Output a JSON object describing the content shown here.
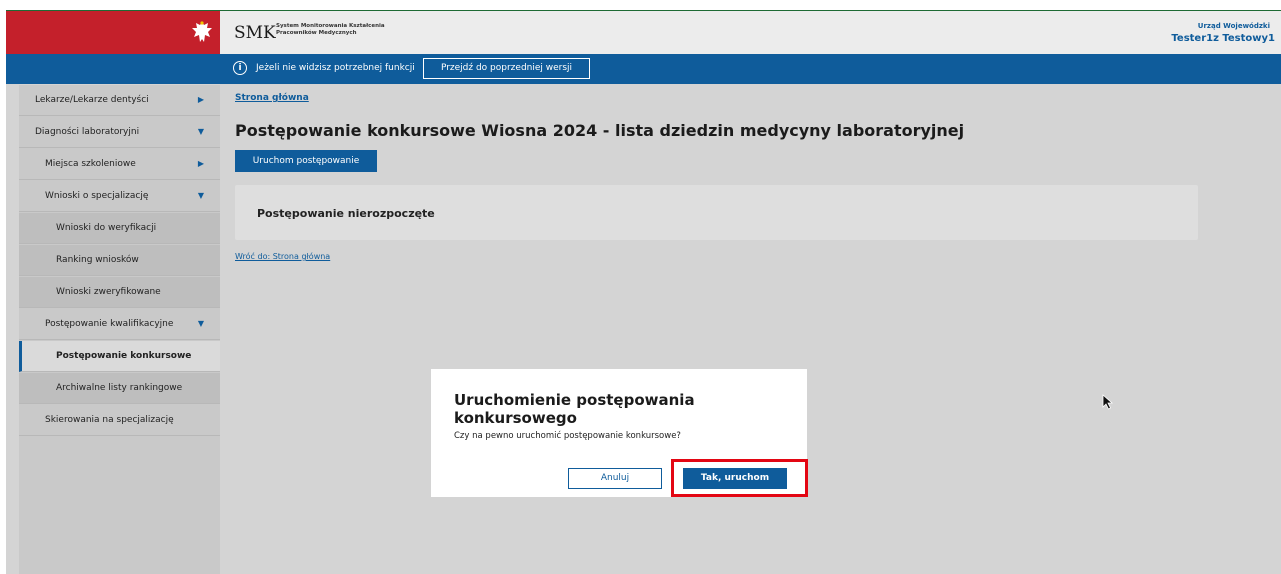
{
  "header": {
    "logo": "SMK",
    "logo_subtitle_line1": "System Monitorowania Kształcenia",
    "logo_subtitle_line2": "Pracowników Medycznych",
    "organization": "Urząd Wojewódzki",
    "user": "Tester1z Testowy1"
  },
  "infobar": {
    "text": "Jeżeli nie widzisz potrzebnej funkcji",
    "button": "Przejdź do poprzedniej wersji"
  },
  "sidebar": {
    "items": [
      {
        "label": "Lekarze/Lekarze dentyści",
        "arrow": "▶"
      },
      {
        "label": "Diagności laboratoryjni",
        "arrow": "▼"
      },
      {
        "label": "Miejsca szkoleniowe",
        "arrow": "▶"
      },
      {
        "label": "Wnioski o specjalizację",
        "arrow": "▼"
      },
      {
        "label": "Wnioski do weryfikacji"
      },
      {
        "label": "Ranking wniosków"
      },
      {
        "label": "Wnioski zweryfikowane"
      },
      {
        "label": "Postępowanie kwalifikacyjne",
        "arrow": "▼"
      },
      {
        "label": "Postępowanie konkursowe"
      },
      {
        "label": "Archiwalne listy rankingowe"
      },
      {
        "label": "Skierowania na specjalizację"
      }
    ]
  },
  "main": {
    "breadcrumb": "Strona główna",
    "title": "Postępowanie konkursowe Wiosna 2024 - lista dziedzin medycyny laboratoryjnej",
    "run_button": "Uruchom postępowanie",
    "panel_title": "Postępowanie nierozpoczęte",
    "back_link": "Wróć do: Strona główna"
  },
  "dialog": {
    "title": "Uruchomienie postępowania konkursowego",
    "text": "Czy na pewno uruchomić postępowanie konkursowe?",
    "cancel": "Anuluj",
    "confirm": "Tak, uruchom"
  },
  "colors": {
    "primary": "#0f5c9b",
    "flag_red": "#c4202b",
    "highlight": "#e30613"
  }
}
